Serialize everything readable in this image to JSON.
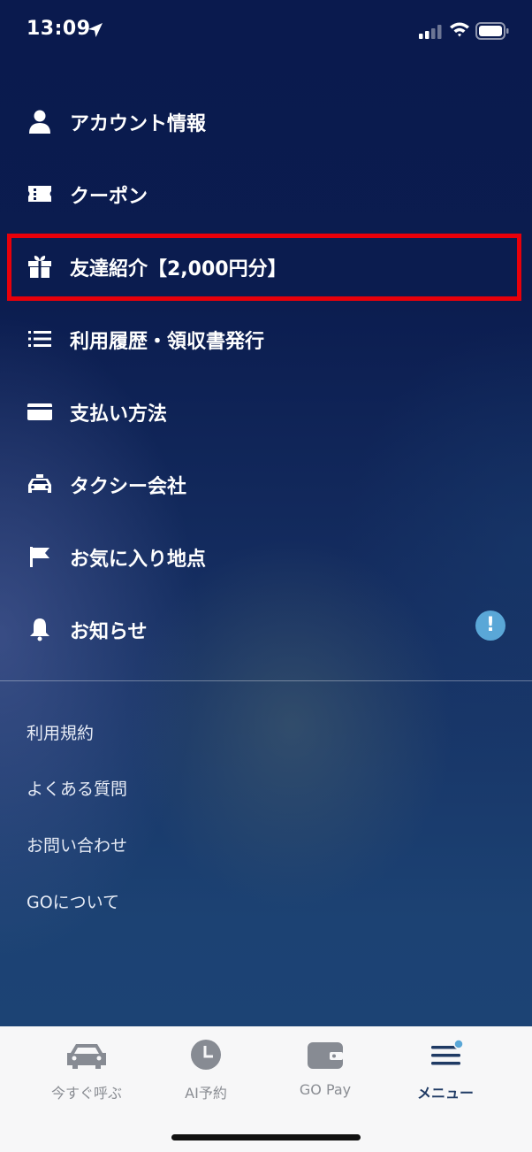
{
  "status_bar": {
    "time": "13:09"
  },
  "menu": {
    "items": [
      {
        "label": "アカウント情報",
        "icon": "person-icon"
      },
      {
        "label": "クーポン",
        "icon": "ticket-icon"
      },
      {
        "label": "友達紹介【2,000円分】",
        "icon": "gift-icon"
      },
      {
        "label": "利用履歴・領収書発行",
        "icon": "list-icon"
      },
      {
        "label": "支払い方法",
        "icon": "card-icon"
      },
      {
        "label": "タクシー会社",
        "icon": "taxi-icon"
      },
      {
        "label": "お気に入り地点",
        "icon": "flag-icon"
      },
      {
        "label": "お知らせ",
        "icon": "bell-icon"
      }
    ],
    "notification_badge": "!",
    "highlight_color": "#e8000a"
  },
  "links": [
    "利用規約",
    "よくある質問",
    "お問い合わせ",
    "GOについて"
  ],
  "tabbar": {
    "tabs": [
      {
        "label": "今すぐ呼ぶ",
        "icon": "car-icon"
      },
      {
        "label": "AI予約",
        "icon": "clock-icon"
      },
      {
        "label": "GO Pay",
        "icon": "wallet-icon"
      },
      {
        "label": "メニュー",
        "icon": "menu-icon",
        "active": true
      }
    ]
  },
  "colors": {
    "accent": "#5aa7d7",
    "active_tab": "#1f3a64"
  }
}
